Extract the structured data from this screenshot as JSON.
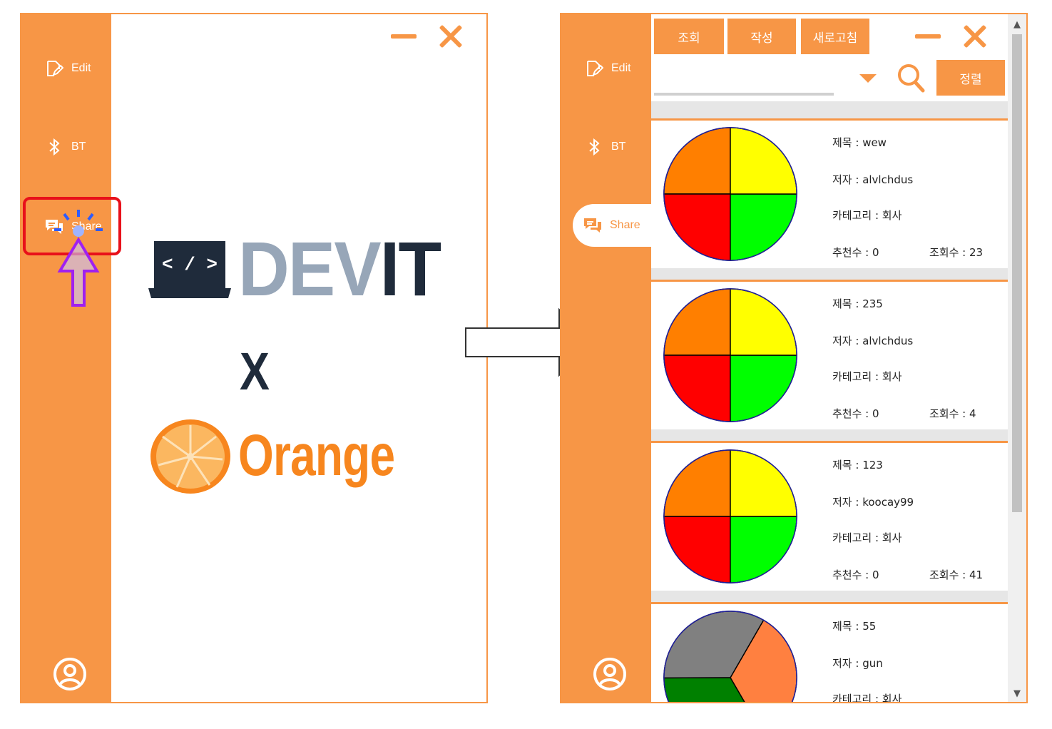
{
  "sidebar": {
    "items": [
      {
        "label": "Edit",
        "icon": "edit-icon"
      },
      {
        "label": "BT",
        "icon": "bluetooth-icon"
      },
      {
        "label": "Share",
        "icon": "chat-icon"
      }
    ]
  },
  "splash": {
    "logo_word_part1": "DEV",
    "logo_word_part2": "IT",
    "laptop_code": "< / >",
    "connector": "X",
    "brand": "Orange"
  },
  "share": {
    "toolbar": {
      "view": "조회",
      "write": "작성",
      "refresh": "새로고침"
    },
    "search_value": "",
    "sort_label": "정렬",
    "posts": [
      {
        "title": "제목 : wew",
        "author": "저자 : alvlchdus",
        "category": "카테고리 : 회사",
        "likes": "추천수 : 0",
        "views": "조회수 : 23",
        "slices": [
          {
            "color": "#ff7f00",
            "fraction": 0.25
          },
          {
            "color": "#ff0000",
            "fraction": 0.25
          },
          {
            "color": "#00ff00",
            "fraction": 0.25
          },
          {
            "color": "#ffff00",
            "fraction": 0.25
          }
        ]
      },
      {
        "title": "제목 : 235",
        "author": "저자 : alvlchdus",
        "category": "카테고리 : 회사",
        "likes": "추천수 : 0",
        "views": "조회수 : 4",
        "slices": [
          {
            "color": "#ff7f00",
            "fraction": 0.25
          },
          {
            "color": "#ff0000",
            "fraction": 0.25
          },
          {
            "color": "#00ff00",
            "fraction": 0.25
          },
          {
            "color": "#ffff00",
            "fraction": 0.25
          }
        ]
      },
      {
        "title": "제목 : 123",
        "author": "저자 : koocay99",
        "category": "카테고리 : 회사",
        "likes": "추천수 : 0",
        "views": "조회수 : 41",
        "slices": [
          {
            "color": "#ff7f00",
            "fraction": 0.25
          },
          {
            "color": "#ff0000",
            "fraction": 0.25
          },
          {
            "color": "#00ff00",
            "fraction": 0.25
          },
          {
            "color": "#ffff00",
            "fraction": 0.25
          }
        ]
      },
      {
        "title": "제목 : 55",
        "author": "저자 : gun",
        "category": "카테고리 : 회사",
        "likes": "",
        "views": "",
        "slices": [
          {
            "color": "#ff8040",
            "fraction": 0.333
          },
          {
            "color": "#008000",
            "fraction": 0.333
          },
          {
            "color": "#808080",
            "fraction": 0.334
          }
        ]
      }
    ]
  },
  "colors": {
    "accent": "#f79646",
    "highlight": "#e8101a",
    "cursor_outline": "#a020f0",
    "dark_logo": "#1f2b3b",
    "gray_logo": "#97a6b8",
    "orange_text": "#f7861e"
  }
}
